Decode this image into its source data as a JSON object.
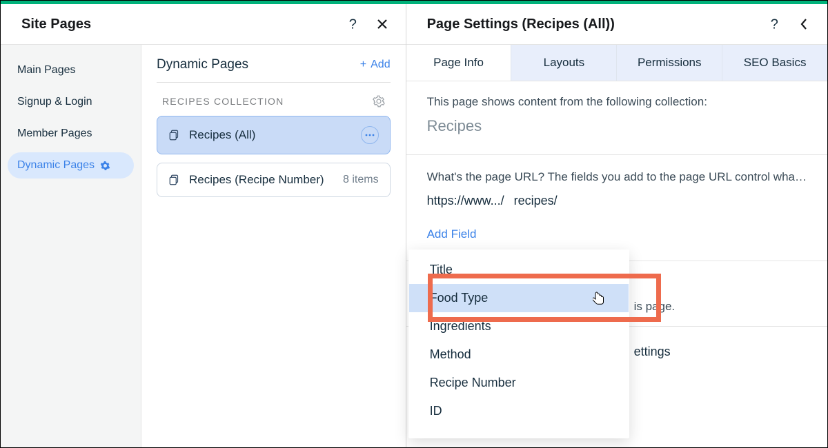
{
  "left": {
    "title": "Site Pages",
    "sidebar": {
      "items": [
        {
          "label": "Main Pages"
        },
        {
          "label": "Signup & Login"
        },
        {
          "label": "Member Pages"
        },
        {
          "label": "Dynamic Pages"
        }
      ]
    },
    "dynamic": {
      "heading": "Dynamic Pages",
      "add_label": "Add",
      "collection_label": "RECIPES COLLECTION",
      "pages": [
        {
          "label": "Recipes (All)",
          "meta": ""
        },
        {
          "label": "Recipes (Recipe Number)",
          "meta": "8 items"
        }
      ]
    }
  },
  "right": {
    "title": "Page Settings (Recipes (All))",
    "tabs": [
      {
        "label": "Page Info"
      },
      {
        "label": "Layouts"
      },
      {
        "label": "Permissions"
      },
      {
        "label": "SEO Basics"
      }
    ],
    "desc": "This page shows content from the following collection:",
    "collection": "Recipes",
    "url_question": "What's the page URL? The fields you add to the page URL control wha…",
    "url_base": "https://www.../",
    "url_path": "recipes/",
    "add_field": "Add Field",
    "hidden_text": "is page.",
    "page_settings_line": "ettings",
    "fields": [
      {
        "label": "Title"
      },
      {
        "label": "Food Type"
      },
      {
        "label": "Ingredients"
      },
      {
        "label": "Method"
      },
      {
        "label": "Recipe Number"
      },
      {
        "label": "ID"
      }
    ]
  }
}
